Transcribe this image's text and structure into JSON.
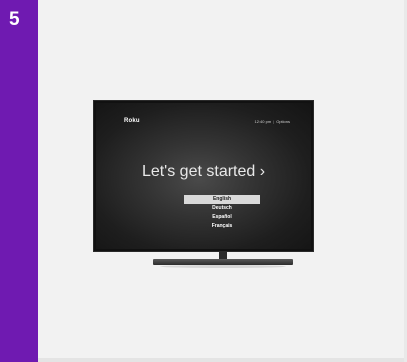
{
  "step": {
    "number": "5"
  },
  "tv": {
    "logo": "Roku",
    "time": "12:40 pm",
    "separator": "|",
    "options": "Options",
    "heading": "Let's get started ›",
    "languages": [
      "English",
      "Deutsch",
      "Español",
      "Français"
    ],
    "selected_language": "English"
  },
  "colors": {
    "accent": "#6f1ab1",
    "card_background": "#f2f2f2",
    "tv_frame": "#111111"
  }
}
